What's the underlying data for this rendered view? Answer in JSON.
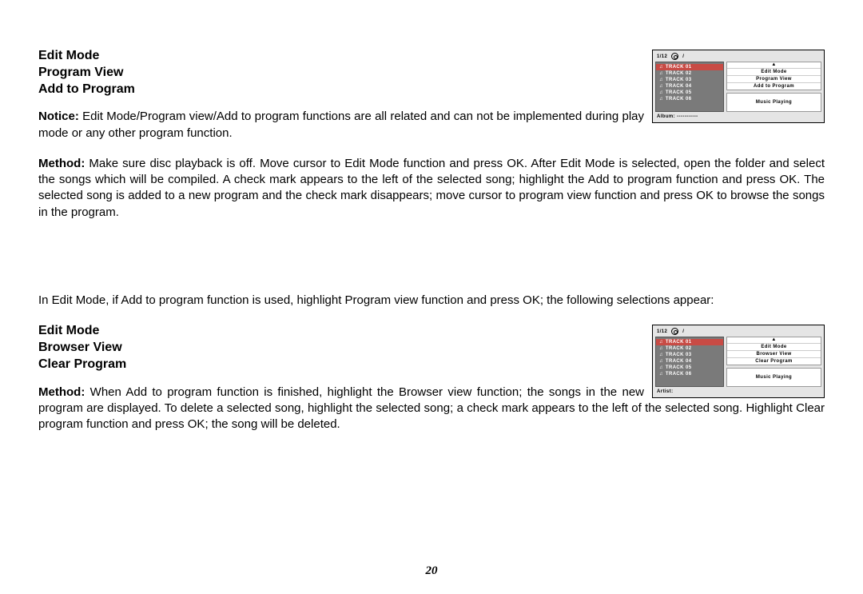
{
  "section1": {
    "h1": "Edit Mode",
    "h2": "Program View",
    "h3": "Add to Program",
    "notice_label": "Notice:",
    "notice_text": " Edit Mode/Program view/Add to program functions are all related and can not be implemented during play mode or any other program function.",
    "method_label": "Method:",
    "method_text": " Make sure disc playback is off. Move cursor to Edit Mode function and press OK. After Edit Mode is selected, open the folder and select the songs which will be compiled. A check mark appears to the left of the selected song; highlight the Add to program function and press OK. The selected song is added to a new program and the check mark disappears; move cursor to program view function and press OK to browse the songs in the program.",
    "midtext": "In Edit Mode, if Add to program function is used, highlight Program view function and press OK; the following selections appear:"
  },
  "section2": {
    "h1": "Edit Mode",
    "h2": "Browser View",
    "h3": "Clear Program",
    "method_label": "Method:",
    "method_text": " When Add to program function is finished, highlight the Browser view function; the songs in the new program are displayed. To delete a selected song, highlight the selected song; a check mark appears to the left of the selected song. Highlight Clear program function and press OK; the song will be deleted."
  },
  "fig1": {
    "counter": "1/12",
    "slash": "/",
    "tracks": [
      "TRACK 01",
      "TRACK 02",
      "TRACK 03",
      "TRACK 04",
      "TRACK 05",
      "TRACK 06"
    ],
    "menu": [
      "Edit  Mode",
      "Program View",
      "Add to Program"
    ],
    "playing": "Music Playing",
    "footer": "Album: -----------"
  },
  "fig2": {
    "counter": "1/12",
    "slash": "/",
    "tracks": [
      "TRACK 01",
      "TRACK 02",
      "TRACK 03",
      "TRACK 04",
      "TRACK 05",
      "TRACK 06"
    ],
    "menu": [
      "Edit  Mode",
      "Browser View",
      "Clear Program"
    ],
    "playing": "Music Playing",
    "footer": "Artist:"
  },
  "page_number": "20"
}
